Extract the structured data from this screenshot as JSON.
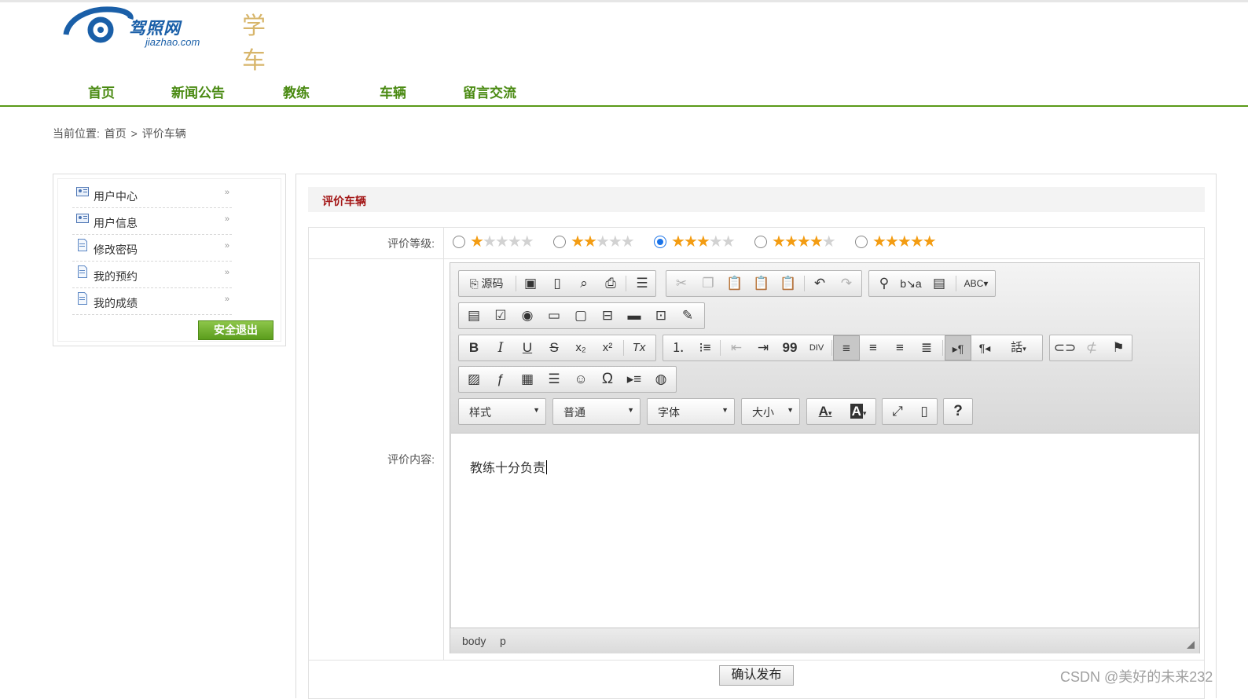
{
  "site": {
    "brand": "驾照网",
    "url": "jiazhao.com",
    "slogan_char": "学车"
  },
  "nav": {
    "items": [
      "首页",
      "新闻公告",
      "教练",
      "车辆",
      "留言交流"
    ]
  },
  "breadcrumb": {
    "prefix": "当前位置:",
    "home": "首页",
    "separator": ">",
    "current": "评价车辆"
  },
  "sidebar": {
    "items": [
      {
        "label": "用户中心",
        "icon": "id-card-icon"
      },
      {
        "label": "用户信息",
        "icon": "id-card-icon"
      },
      {
        "label": "修改密码",
        "icon": "document-icon"
      },
      {
        "label": "我的预约",
        "icon": "document-icon"
      },
      {
        "label": "我的成绩",
        "icon": "document-icon"
      }
    ],
    "arrow": "»",
    "logout_label": "安全退出"
  },
  "panel": {
    "title": "评价车辆"
  },
  "form": {
    "rating_label": "评价等级:",
    "content_label": "评价内容:",
    "ratings": [
      {
        "stars": 1,
        "selected": false
      },
      {
        "stars": 2,
        "selected": false
      },
      {
        "stars": 3,
        "selected": true
      },
      {
        "stars": 4,
        "selected": false
      },
      {
        "stars": 5,
        "selected": false
      }
    ],
    "max_stars": 5,
    "submit_label": "确认发布"
  },
  "editor": {
    "source_label": "源码",
    "combos": [
      {
        "name": "styles-combo",
        "label": "样式"
      },
      {
        "name": "format-combo",
        "label": "普通"
      },
      {
        "name": "font-combo",
        "label": "字体"
      },
      {
        "name": "size-combo",
        "label": "大小"
      }
    ],
    "content_text": "教练十分负责",
    "path": [
      "body",
      "p"
    ],
    "icons": {
      "save": "save-icon",
      "new": "new-page-icon",
      "preview": "preview-icon",
      "print": "print-icon",
      "templates": "templates-icon",
      "cut": "cut-icon",
      "copy": "copy-icon",
      "paste": "paste-icon",
      "undo": "undo-icon",
      "redo": "redo-icon",
      "find": "find-icon",
      "replace": "replace-icon",
      "bold": "bold-icon",
      "italic": "italic-icon",
      "underline": "underline-icon",
      "strike": "strikethrough-icon",
      "link": "link-icon",
      "unlink": "unlink-icon",
      "anchor": "anchor-flag-icon",
      "image": "image-icon",
      "flash": "flash-icon",
      "table": "table-icon",
      "smiley": "smiley-icon",
      "special_char": "omega-icon",
      "maximize": "maximize-icon",
      "help": "help-icon"
    },
    "glyphs": {
      "bold": "B",
      "italic": "I",
      "underline": "U",
      "strike": "S",
      "sub": "x₂",
      "sup": "x²",
      "clear": "Tx",
      "blockquote": "99",
      "ltr": "▸¶",
      "rtl": "¶◂",
      "lang": "話",
      "omega": "Ω",
      "help": "?",
      "cut": "✂",
      "undo": "↶",
      "redo": "↷",
      "find": "🔍",
      "link": "🔗",
      "flag": "⚑",
      "smiley": "☺",
      "globe": "◍",
      "font_color": "A",
      "bg_color": "A"
    }
  },
  "watermark": "CSDN @美好的未来232"
}
